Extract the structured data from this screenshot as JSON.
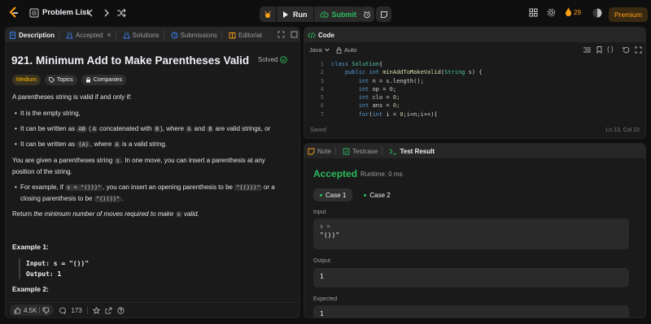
{
  "topbar": {
    "problem_list_label": "Problem List",
    "run_label": "Run",
    "submit_label": "Submit",
    "streak_count": "29",
    "premium_label": "Premium"
  },
  "desc_panel": {
    "tabs": [
      {
        "label": "Description"
      },
      {
        "label": "Accepted"
      },
      {
        "label": "Solutions"
      },
      {
        "label": "Submissions"
      },
      {
        "label": "Editorial"
      }
    ],
    "title": "921. Minimum Add to Make Parentheses Valid",
    "solved_label": "Solved",
    "difficulty": "Medium",
    "topics_label": "Topics",
    "companies_label": "Companies",
    "intro": "A parentheses string is valid if and only if:",
    "bullet1": "It is the empty string,",
    "bullet2_a": "It can be written as ",
    "bullet2_code1": "AB",
    "bullet2_b": " (",
    "bullet2_code2": "A",
    "bullet2_c": " concatenated with ",
    "bullet2_code3": "B",
    "bullet2_d": "), where ",
    "bullet2_code4": "A",
    "bullet2_e": " and ",
    "bullet2_code5": "B",
    "bullet2_f": " are valid strings, or",
    "bullet3_a": "It can be written as ",
    "bullet3_code1": "(A)",
    "bullet3_b": ", where ",
    "bullet3_code2": "A",
    "bullet3_c": " is a valid string.",
    "para2_a": "You are given a parentheses string ",
    "para2_code": "s",
    "para2_b": ". In one move, you can insert a parenthesis at any position of the string.",
    "ex_bullet_a": "For example, if ",
    "ex_bullet_code1": "s = \"()))\"",
    "ex_bullet_b": ", you can insert an opening parenthesis to be ",
    "ex_bullet_code2": "\"(()))\"",
    "ex_bullet_c": " or a closing parenthesis to be ",
    "ex_bullet_code3": "\"())))\"",
    "ex_bullet_d": ".",
    "ret_a": "Return ",
    "ret_b": "the minimum number of moves required to make ",
    "ret_code": "s",
    "ret_c": " valid.",
    "example1_title": "Example 1:",
    "example1_input": "Input: s = \"())\"",
    "example1_output": "Output: 1",
    "example2_title": "Example 2:",
    "likes": "4.5K",
    "comments": "173"
  },
  "code_panel": {
    "title": "Code",
    "language": "Java",
    "mode": "Auto",
    "line_numbers": [
      "1",
      "2",
      "3",
      "4",
      "5",
      "6",
      "7"
    ],
    "status": "Saved",
    "cursor": "Ln 13, Col 22"
  },
  "result_panel": {
    "tabs": [
      {
        "label": "Note"
      },
      {
        "label": "Testcase"
      },
      {
        "label": "Test Result"
      }
    ],
    "verdict": "Accepted",
    "runtime": "Runtime: 0 ms",
    "case1": "Case 1",
    "case2": "Case 2",
    "input_label": "Input",
    "input_var": "s =",
    "input_value": "\"())\"",
    "output_label": "Output",
    "output_value": "1",
    "expected_label": "Expected",
    "expected_value": "1"
  },
  "colors": {
    "accent_green": "#2cbb5d",
    "accent_orange": "#ffa116",
    "medium_yellow": "#ffb800"
  }
}
